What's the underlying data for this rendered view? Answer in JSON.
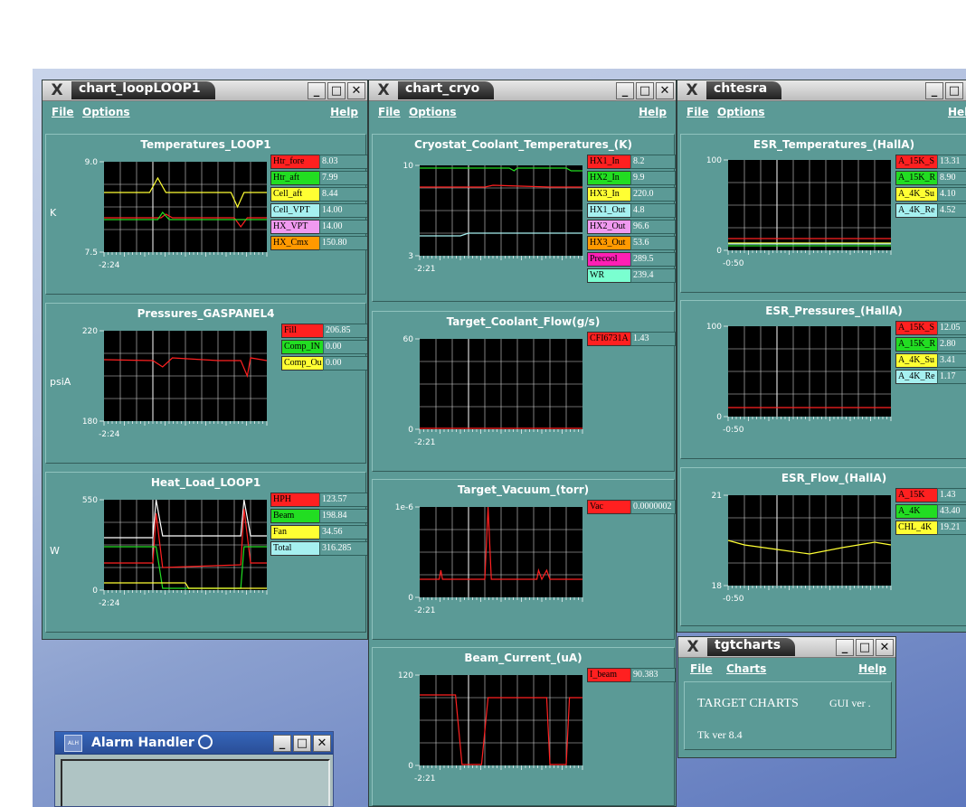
{
  "windows": {
    "loop": {
      "title": "chart_loopLOOP1",
      "menu": {
        "file": "File",
        "options": "Options",
        "help": "Help"
      }
    },
    "cryo": {
      "title": "chart_cryo",
      "menu": {
        "file": "File",
        "options": "Options",
        "help": "Help"
      }
    },
    "esr": {
      "title": "chtesra",
      "menu": {
        "file": "File",
        "options": "Options",
        "help": "Help"
      }
    },
    "tgt": {
      "title": "tgtcharts",
      "menu": {
        "file": "File",
        "charts": "Charts",
        "help": "Help"
      },
      "heading": "TARGET CHARTS",
      "gui": "GUI ver .",
      "tk": "Tk ver 8.4"
    },
    "alarm": {
      "title": "Alarm Handler",
      "icon_text": "ALH"
    }
  },
  "window_buttons": {
    "minimize": "_",
    "maximize": "□",
    "close": "✕"
  },
  "icons": {
    "window_menu": "X",
    "alarm_badge": "sticky-icon"
  },
  "colors": {
    "red": "#ff2020",
    "green": "#22dd22",
    "yellow": "#ffff33",
    "cyan": "#a6f0f0",
    "violet": "#f09af0",
    "orange": "#ff9900",
    "magenta": "#ff1fb4",
    "mint": "#7affd0",
    "white": "#ffffff"
  },
  "charts": [
    {
      "id": "temps_loop1",
      "title": "Temperatures_LOOP1",
      "ylabel": "K",
      "ymax": "9.0",
      "ymin": "7.5",
      "xstart": "-2:24",
      "legend": [
        {
          "name": "Htr_fore",
          "value": "8.03",
          "color": "#ff2020"
        },
        {
          "name": "Htr_aft",
          "value": "7.99",
          "color": "#22dd22"
        },
        {
          "name": "Cell_aft",
          "value": "8.44",
          "color": "#ffff33"
        },
        {
          "name": "Cell_VPT",
          "value": "14.00",
          "color": "#a6f0f0"
        },
        {
          "name": "HX_VPT",
          "value": "14.00",
          "color": "#f09af0"
        },
        {
          "name": "HX_Cmx",
          "value": "150.80",
          "color": "#ff9900"
        }
      ]
    },
    {
      "id": "press_gaspanel4",
      "title": "Pressures_GASPANEL4",
      "ylabel": "psiA",
      "ymax": "220",
      "ymin": "180",
      "xstart": "-2:24",
      "legend": [
        {
          "name": "Fill",
          "value": "206.85",
          "color": "#ff2020"
        },
        {
          "name": "Comp_IN",
          "value": "0.00",
          "color": "#22dd22"
        },
        {
          "name": "Comp_Ou",
          "value": "0.00",
          "color": "#ffff33"
        }
      ]
    },
    {
      "id": "heat_loop1",
      "title": "Heat_Load_LOOP1",
      "ylabel": "W",
      "ymax": "550",
      "ymin": "0",
      "xstart": "-2:24",
      "legend": [
        {
          "name": "HPH",
          "value": "123.57",
          "color": "#ff2020"
        },
        {
          "name": "Beam",
          "value": "198.84",
          "color": "#22dd22"
        },
        {
          "name": "Fan",
          "value": "34.56",
          "color": "#ffff33"
        },
        {
          "name": "Total",
          "value": "316.285",
          "color": "#a6f0f0"
        }
      ]
    },
    {
      "id": "cryo_temps",
      "title": "Cryostat_Coolant_Temperatures_(K)",
      "ylabel": "",
      "ymax": "10",
      "ymin": "3",
      "xstart": "-2:21",
      "legend": [
        {
          "name": "HX1_In",
          "value": "8.2",
          "color": "#ff2020"
        },
        {
          "name": "HX2_In",
          "value": "9.9",
          "color": "#22dd22"
        },
        {
          "name": "HX3_In",
          "value": "220.0",
          "color": "#ffff33"
        },
        {
          "name": "HX1_Out",
          "value": "4.8",
          "color": "#a6f0f0"
        },
        {
          "name": "HX2_Out",
          "value": "96.6",
          "color": "#f09af0"
        },
        {
          "name": "HX3_Out",
          "value": "53.6",
          "color": "#ff9900"
        },
        {
          "name": "Precool",
          "value": "289.5",
          "color": "#ff1fb4"
        },
        {
          "name": "WR",
          "value": "239.4",
          "color": "#7affd0"
        }
      ]
    },
    {
      "id": "coolant_flow",
      "title": "Target_Coolant_Flow(g/s)",
      "ylabel": "",
      "ymax": "60",
      "ymin": "0",
      "xstart": "-2:21",
      "legend": [
        {
          "name": "CFI6731A",
          "value": "1.43",
          "color": "#ff2020"
        }
      ]
    },
    {
      "id": "target_vacuum",
      "title": "Target_Vacuum_(torr)",
      "ylabel": "",
      "ymax": "1e-6",
      "ymin": "0",
      "xstart": "-2:21",
      "legend": [
        {
          "name": "Vac",
          "value": "0.0000002",
          "color": "#ff2020"
        }
      ]
    },
    {
      "id": "beam_current",
      "title": "Beam_Current_(uA)",
      "ylabel": "",
      "ymax": "120",
      "ymin": "0",
      "xstart": "-2:21",
      "legend": [
        {
          "name": "I_beam",
          "value": "90.383",
          "color": "#ff2020"
        }
      ]
    },
    {
      "id": "esr_temps",
      "title": "ESR_Temperatures_(HallA)",
      "ylabel": "",
      "ymax": "100",
      "ymin": "0",
      "xstart": "-0:50",
      "legend": [
        {
          "name": "A_15K_S",
          "value": "13.31",
          "color": "#ff2020"
        },
        {
          "name": "A_15K_R",
          "value": "8.90",
          "color": "#22dd22"
        },
        {
          "name": "A_4K_Su",
          "value": "4.10",
          "color": "#ffff33"
        },
        {
          "name": "A_4K_Re",
          "value": "4.52",
          "color": "#a6f0f0"
        }
      ]
    },
    {
      "id": "esr_press",
      "title": "ESR_Pressures_(HallA)",
      "ylabel": "",
      "ymax": "100",
      "ymin": "0",
      "xstart": "-0:50",
      "legend": [
        {
          "name": "A_15K_S",
          "value": "12.05",
          "color": "#ff2020"
        },
        {
          "name": "A_15K_R",
          "value": "2.80",
          "color": "#22dd22"
        },
        {
          "name": "A_4K_Su",
          "value": "3.41",
          "color": "#ffff33"
        },
        {
          "name": "A_4K_Re",
          "value": "1.17",
          "color": "#a6f0f0"
        }
      ]
    },
    {
      "id": "esr_flow",
      "title": "ESR_Flow_(HallA)",
      "ylabel": "",
      "ymax": "21",
      "ymin": "18",
      "xstart": "-0:50",
      "legend": [
        {
          "name": "A_15K",
          "value": "1.43",
          "color": "#ff2020"
        },
        {
          "name": "A_4K",
          "value": "43.40",
          "color": "#22dd22"
        },
        {
          "name": "CHL_4K",
          "value": "19.21",
          "color": "#ffff33"
        }
      ]
    }
  ]
}
